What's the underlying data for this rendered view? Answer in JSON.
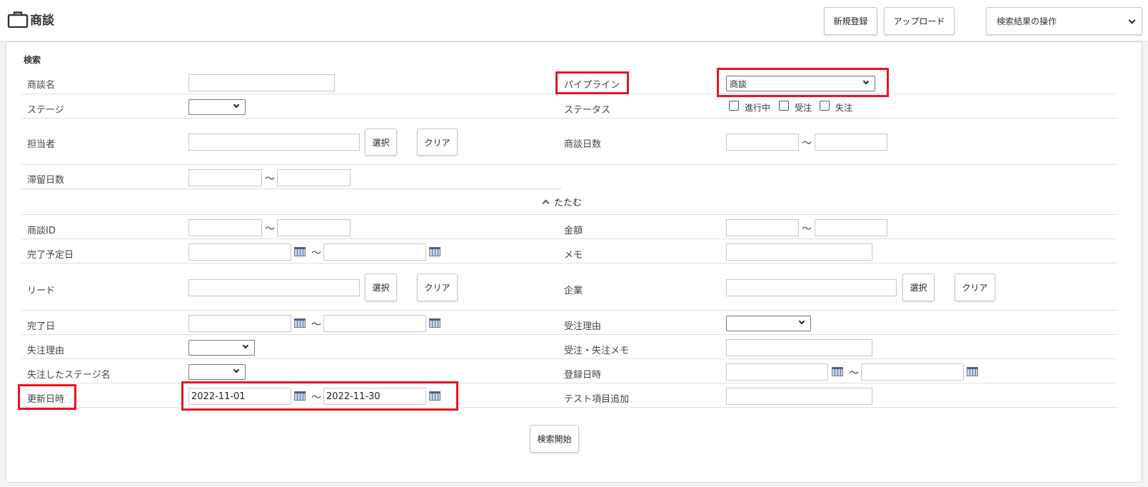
{
  "header": {
    "title": "商談",
    "new_button": "新規登録",
    "upload_button": "アップロード",
    "ops_select": "検索結果の操作"
  },
  "search": {
    "section_title": "検索",
    "fold_label": "たたむ",
    "submit_button": "検索開始",
    "tilde": "～",
    "select_button": "選択",
    "clear_button": "クリア",
    "labels": {
      "deal_name": "商談名",
      "pipeline": "パイプライン",
      "stage": "ステージ",
      "status": "ステータス",
      "owner": "担当者",
      "deal_days": "商談日数",
      "stay_days": "滞留日数",
      "deal_id": "商談ID",
      "amount": "金額",
      "planned_date": "完了予定日",
      "memo": "メモ",
      "lead": "リード",
      "company": "企業",
      "completed_date": "完了日",
      "won_reason": "受注理由",
      "lost_reason": "失注理由",
      "won_lost_memo": "受注・失注メモ",
      "lost_stage": "失注したステージ名",
      "registered_at": "登録日時",
      "updated_at": "更新日時",
      "test_item": "テスト項目追加"
    },
    "pipeline_value": "商談",
    "status_options": [
      "進行中",
      "受注",
      "失注"
    ],
    "updated_from": "2022-11-01",
    "updated_to": "2022-11-30"
  },
  "colors": {
    "highlight": "#e8141e",
    "panel_bg": "#ffffff",
    "page_bg": "#f2f2f2"
  }
}
